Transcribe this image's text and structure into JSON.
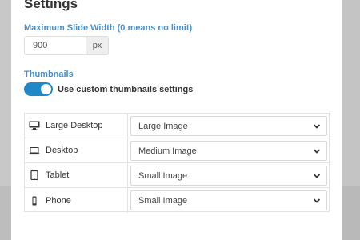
{
  "settings": {
    "title": "Settings",
    "max_width": {
      "label": "Maximum Slide Width (0 means no limit)",
      "value": "900",
      "unit": "px"
    },
    "thumbnails": {
      "section_label": "Thumbnails",
      "toggle_label": "Use custom thumbnails settings",
      "toggle_on": true,
      "devices": [
        {
          "name": "Large Desktop",
          "icon": "monitor-icon",
          "size": "Large Image"
        },
        {
          "name": "Desktop",
          "icon": "laptop-icon",
          "size": "Medium Image"
        },
        {
          "name": "Tablet",
          "icon": "tablet-icon",
          "size": "Small Image"
        },
        {
          "name": "Phone",
          "icon": "phone-icon",
          "size": "Small Image"
        }
      ]
    }
  },
  "colors": {
    "accent": "#4a90c8",
    "toggle": "#1e88c8",
    "text": "#333333"
  }
}
